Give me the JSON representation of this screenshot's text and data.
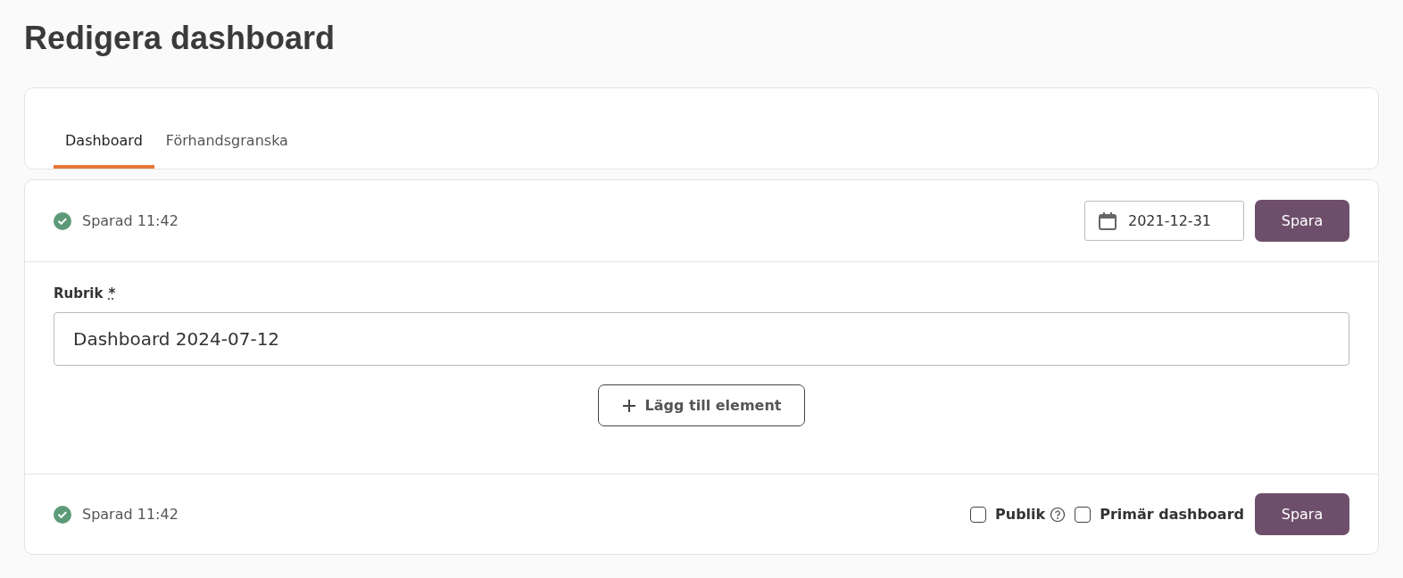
{
  "page_title": "Redigera dashboard",
  "tabs": [
    {
      "label": "Dashboard",
      "selected": true
    },
    {
      "label": "Förhandsgranska",
      "selected": false
    }
  ],
  "header": {
    "status": "Sparad 11:42",
    "date": "2021-12-31",
    "save_button": "Spara"
  },
  "form": {
    "label": "Rubrik",
    "required_mark": "*",
    "value": "Dashboard 2024-07-12",
    "add_button": "Lägg till element"
  },
  "footer": {
    "status": "Sparad 11:42",
    "checkboxes": [
      {
        "label": "Publik",
        "checked": false,
        "help": true
      },
      {
        "label": "Primär dashboard",
        "checked": false,
        "help": false
      }
    ],
    "save_button": "Spara"
  }
}
